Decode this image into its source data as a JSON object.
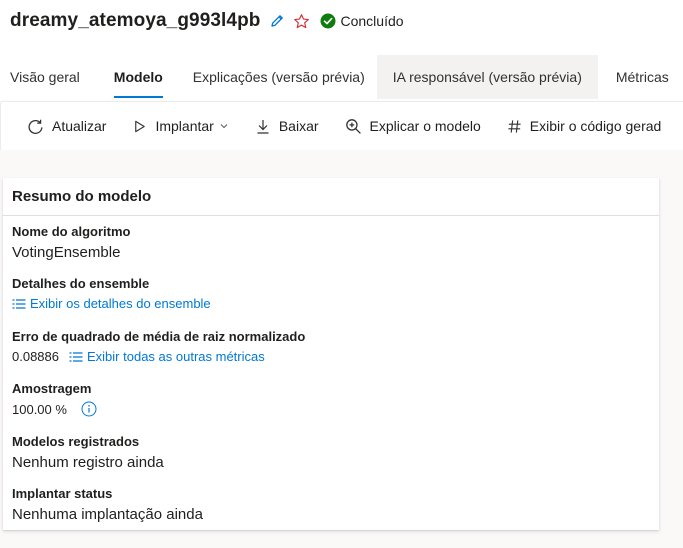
{
  "header": {
    "title": "dreamy_atemoya_g993l4pb",
    "status": "Concluído",
    "accent": "#0078d4",
    "status_color": "#107c10"
  },
  "tabs": [
    {
      "label": "Visão geral"
    },
    {
      "label": "Modelo"
    },
    {
      "label": "Explicações (versão prévia)"
    },
    {
      "label": "IA responsável (versão prévia)"
    },
    {
      "label": "Métricas"
    }
  ],
  "toolbar": {
    "refresh": "Atualizar",
    "deploy": "Implantar",
    "download": "Baixar",
    "explain": "Explicar o modelo",
    "view_code": "Exibir o código gerad"
  },
  "summary": {
    "title": "Resumo do modelo",
    "algorithm_label": "Nome do algoritmo",
    "algorithm_value": "VotingEnsemble",
    "ensemble_label": "Detalhes do ensemble",
    "ensemble_link": "Exibir os detalhes do ensemble",
    "metric_label": "Erro de quadrado de média de raiz normalizado",
    "metric_value": "0.08886",
    "metric_link": "Exibir todas as outras métricas",
    "sampling_label": "Amostragem",
    "sampling_value": "100.00 %",
    "registered_label": "Modelos registrados",
    "registered_value": "Nenhum registro ainda",
    "deploy_label": "Implantar status",
    "deploy_value": "Nenhuma implantação ainda"
  }
}
